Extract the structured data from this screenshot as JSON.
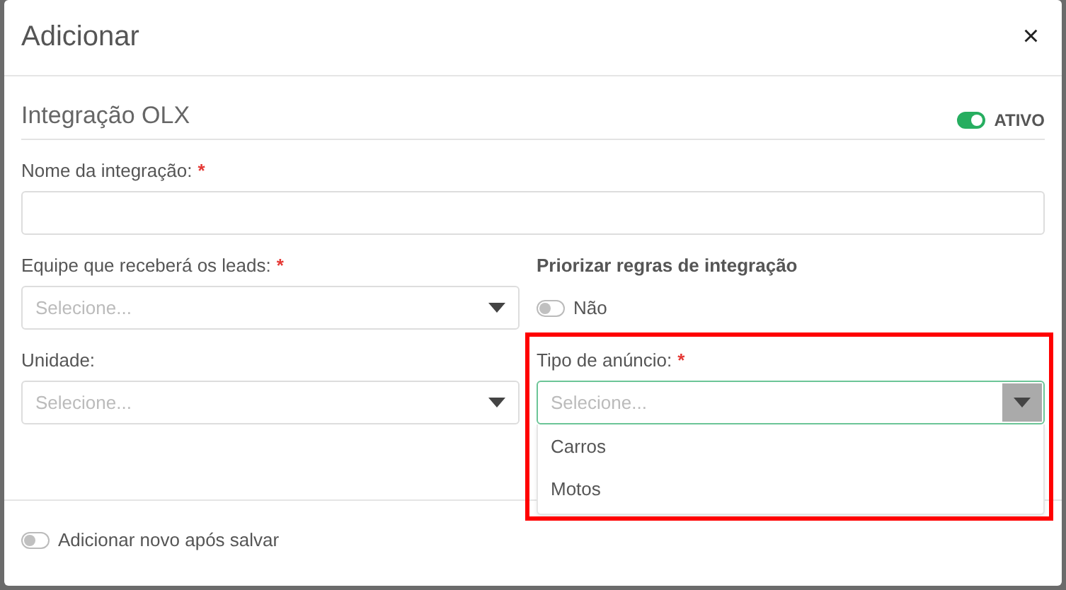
{
  "dialog": {
    "title": "Adicionar",
    "close": "×"
  },
  "section": {
    "title": "Integração OLX",
    "toggle": {
      "on": true,
      "label": "ATIVO"
    }
  },
  "rows": [
    [
      {
        "kind": "text",
        "label": "Nome da integração:",
        "required_mark": "*"
      }
    ],
    [
      {
        "kind": "select",
        "label": "Equipe que receberá os leads:",
        "required_mark": "*",
        "placeholder": "Selecione...",
        "expanded": false
      },
      {
        "kind": "toggle",
        "label": "Priorizar regras de integração",
        "on": false,
        "value_label": "Não"
      }
    ],
    [
      {
        "kind": "select",
        "label": "Unidade:",
        "placeholder": "Selecione...",
        "expanded": false
      },
      {
        "kind": "select",
        "label": "Tipo de anúncio:",
        "required_mark": "*",
        "placeholder": "Selecione...",
        "expanded": true,
        "highlighted": true,
        "options": [
          "Carros",
          "Motos"
        ]
      }
    ]
  ],
  "footer": {
    "toggle": {
      "on": false,
      "label": "Adicionar novo após salvar"
    }
  }
}
